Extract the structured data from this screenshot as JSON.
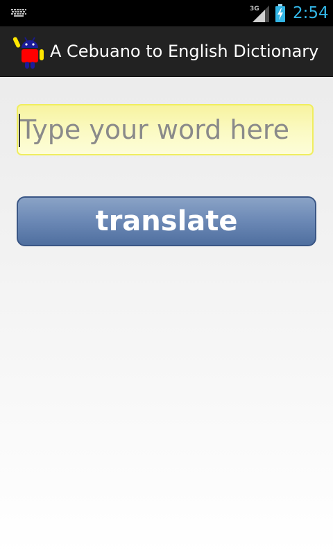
{
  "status_bar": {
    "time": "2:54",
    "network_type": "3G",
    "icons": [
      "keyboard-icon",
      "signal-icon",
      "battery-charging-icon"
    ],
    "clock_color": "#33b5e5"
  },
  "action_bar": {
    "title": "A Cebuano to English Dictionary",
    "icon": "android-robot-icon"
  },
  "main": {
    "word_input": {
      "placeholder": "Type your word here",
      "value": ""
    },
    "translate_button": {
      "label": "translate"
    }
  },
  "colors": {
    "action_bar_bg": "#222222",
    "input_bg": "#fbfac4",
    "input_border": "#f0ee5e",
    "button_bg": "#6b88b5",
    "button_border": "#3a5685"
  }
}
